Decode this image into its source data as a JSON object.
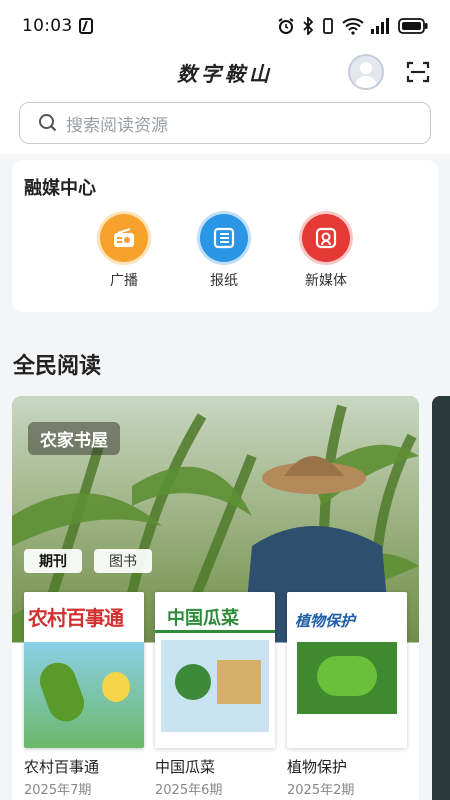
{
  "status": {
    "time": "10:03"
  },
  "header": {
    "title": "数字鞍山"
  },
  "search": {
    "placeholder": "搜索阅读资源"
  },
  "media_center": {
    "title": "融媒中心",
    "items": [
      {
        "label": "广播",
        "icon": "radio-icon",
        "color": "#f6a12b"
      },
      {
        "label": "报纸",
        "icon": "newspaper-icon",
        "color": "#2b95e6"
      },
      {
        "label": "新媒体",
        "icon": "new-media-icon",
        "color": "#e53935"
      }
    ]
  },
  "reading": {
    "title": "全民阅读",
    "banner_tag": "农家书屋",
    "tabs": [
      {
        "label": "期刊",
        "active": true
      },
      {
        "label": "图书",
        "active": false
      }
    ],
    "magazines": [
      {
        "name": "农村百事通",
        "issue": "2025年7期",
        "cover_title": "农村百事通"
      },
      {
        "name": "中国瓜菜",
        "issue": "2025年6期",
        "cover_title": "中国瓜菜"
      },
      {
        "name": "植物保护",
        "issue": "2025年2期",
        "cover_title": "植物保护"
      }
    ]
  }
}
